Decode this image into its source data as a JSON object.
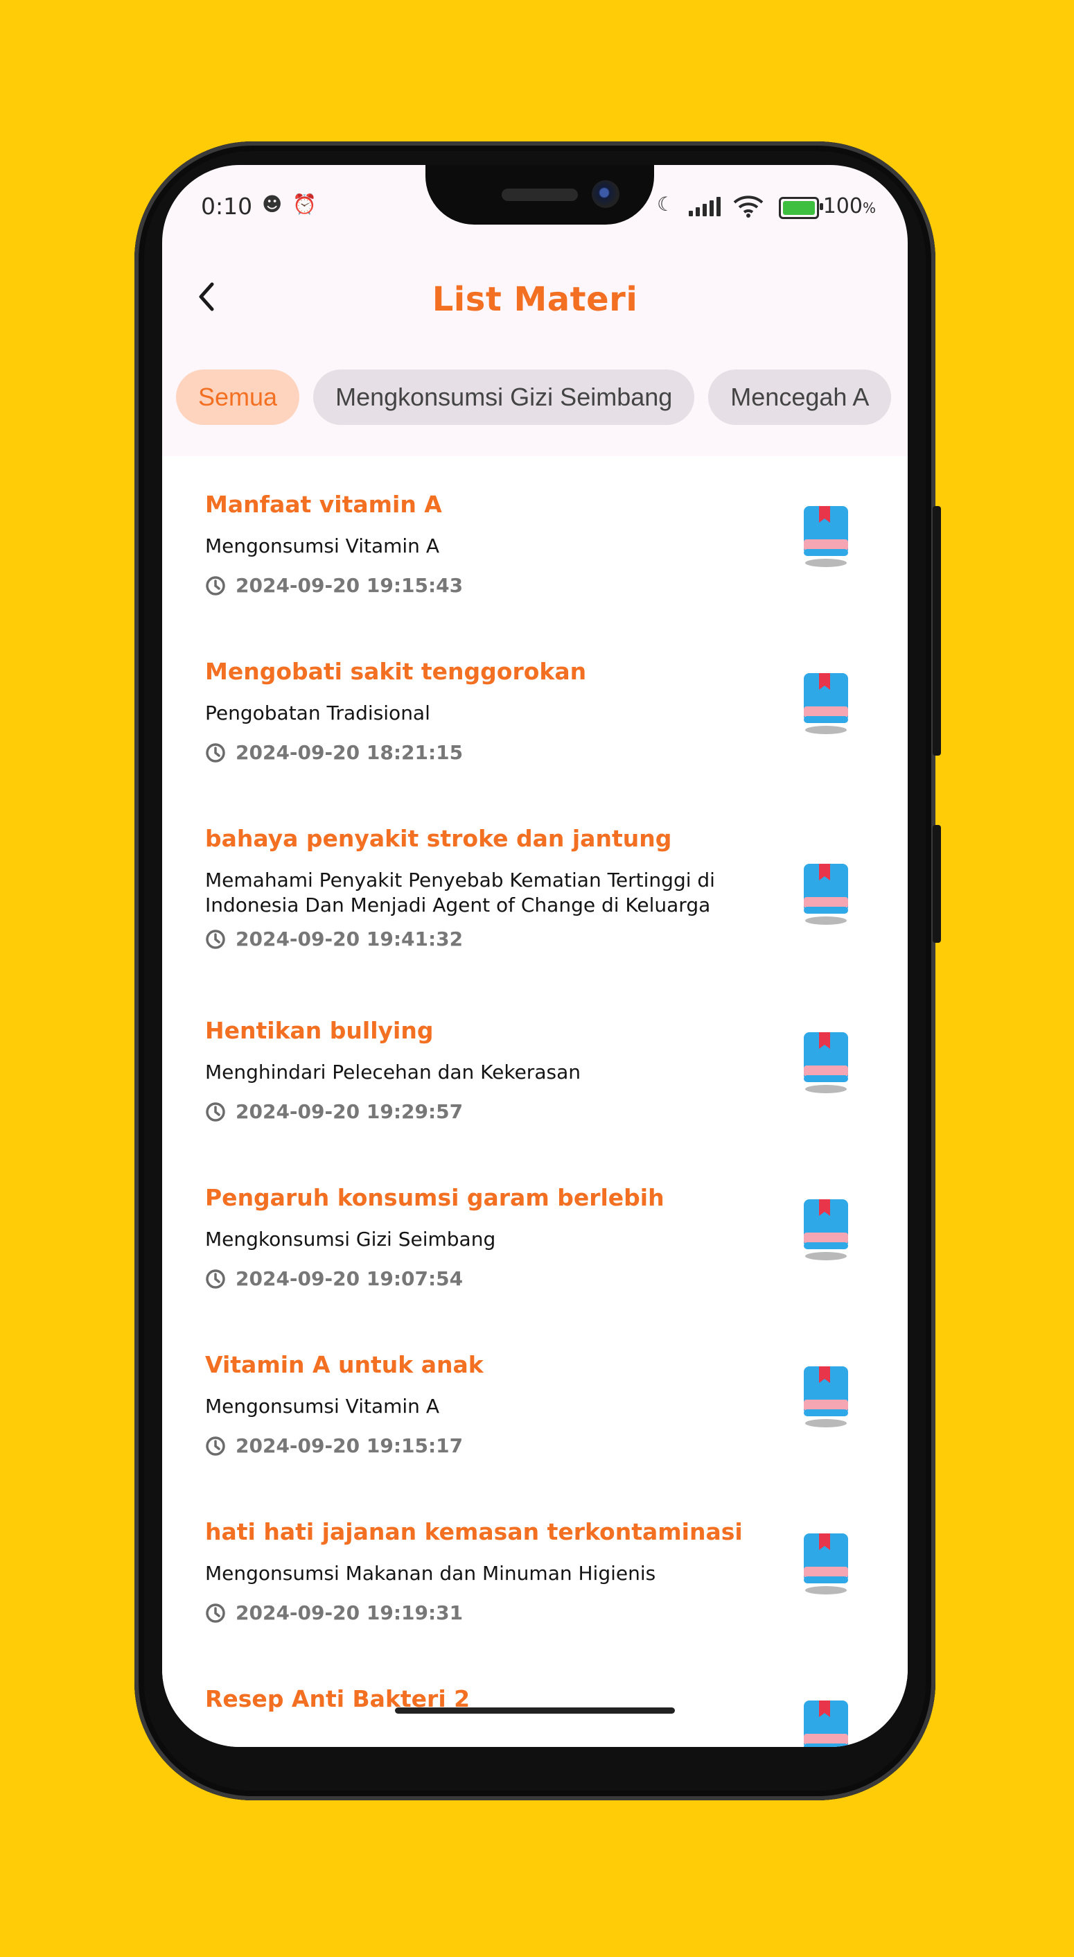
{
  "status_bar": {
    "time": "0:10",
    "battery_percent": "100",
    "battery_unit": "%",
    "icons": [
      "notification-icon",
      "alarm-icon",
      "moon-icon",
      "signal-icon",
      "wifi-icon",
      "battery-icon"
    ]
  },
  "header": {
    "title": "List Materi",
    "back_icon": "chevron-left-icon"
  },
  "filters": {
    "chips": [
      {
        "label": "Semua",
        "active": true
      },
      {
        "label": "Mengkonsumsi Gizi Seimbang",
        "active": false
      },
      {
        "label": "Mencegah A",
        "active": false
      }
    ]
  },
  "materials": [
    {
      "title": "Manfaat vitamin A",
      "category": "Mengonsumsi Vitamin A",
      "date": "2024-09-20 19:15:43"
    },
    {
      "title": "Mengobati sakit tenggorokan",
      "category": "Pengobatan Tradisional",
      "date": "2024-09-20 18:21:15"
    },
    {
      "title": "bahaya penyakit stroke dan jantung",
      "category": "Memahami Penyakit Penyebab Kematian Tertinggi di Indonesia Dan Menjadi Agent of Change di Keluarga",
      "date": "2024-09-20 19:41:32"
    },
    {
      "title": "Hentikan bullying",
      "category": "Menghindari Pelecehan dan Kekerasan",
      "date": "2024-09-20 19:29:57"
    },
    {
      "title": "Pengaruh konsumsi garam berlebih",
      "category": "Mengkonsumsi Gizi Seimbang",
      "date": "2024-09-20 19:07:54"
    },
    {
      "title": "Vitamin A untuk anak",
      "category": "Mengonsumsi Vitamin A",
      "date": "2024-09-20 19:15:17"
    },
    {
      "title": "hati hati jajanan kemasan terkontaminasi",
      "category": "Mengonsumsi Makanan dan Minuman Higienis",
      "date": "2024-09-20 19:19:31"
    },
    {
      "title": "Resep Anti Bakteri 2",
      "category": "",
      "date": ""
    }
  ],
  "colors": {
    "background": "#FFCC07",
    "accent": "#F36F21",
    "chip_active_bg": "#FFD4BE",
    "chip_bg": "#E6E0E6",
    "book_blue": "#2FA8E8",
    "book_pink": "#F6A6B2",
    "bookmark_red": "#E8354A"
  }
}
